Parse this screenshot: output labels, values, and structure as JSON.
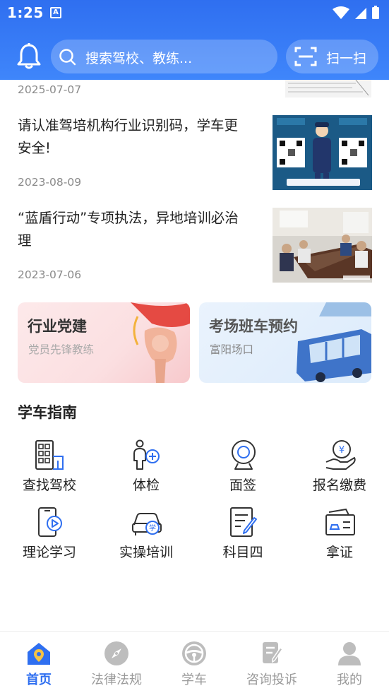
{
  "status_bar": {
    "time": "1:25",
    "a_icon": "A"
  },
  "header": {
    "search_placeholder": "搜索驾校、教练...",
    "scan_label": "扫一扫",
    "accent": "#2f6ff0"
  },
  "news": {
    "partial_date": "2025-07-07",
    "items": [
      {
        "title": "请认准驾培机构行业识别码，学车更安全!",
        "date": "2023-08-09",
        "thumb": "qr-poster-image"
      },
      {
        "title": "“蓝盾行动”专项执法，异地培训必治理",
        "date": "2023-07-06",
        "thumb": "meeting-photo"
      }
    ]
  },
  "banners": [
    {
      "title": "行业党建",
      "subtitle": "党员先锋教练"
    },
    {
      "title": "考场班车预约",
      "subtitle": "富阳场口"
    }
  ],
  "guide": {
    "title": "学车指南",
    "items": [
      {
        "label": "查找驾校",
        "icon": "school-building-icon"
      },
      {
        "label": "体检",
        "icon": "medical-check-icon"
      },
      {
        "label": "面签",
        "icon": "camera-icon"
      },
      {
        "label": "报名缴费",
        "icon": "payment-icon"
      },
      {
        "label": "理论学习",
        "icon": "video-phone-icon"
      },
      {
        "label": "实操培训",
        "icon": "car-training-icon"
      },
      {
        "label": "科目四",
        "icon": "exam-paper-icon"
      },
      {
        "label": "拿证",
        "icon": "license-icon"
      }
    ]
  },
  "bottom_nav": [
    {
      "label": "首页",
      "icon": "home-icon",
      "active": true
    },
    {
      "label": "法律法规",
      "icon": "compass-icon",
      "active": false
    },
    {
      "label": "学车",
      "icon": "steering-wheel-icon",
      "active": false
    },
    {
      "label": "咨询投诉",
      "icon": "complaint-icon",
      "active": false
    },
    {
      "label": "我的",
      "icon": "user-icon",
      "active": false
    }
  ]
}
